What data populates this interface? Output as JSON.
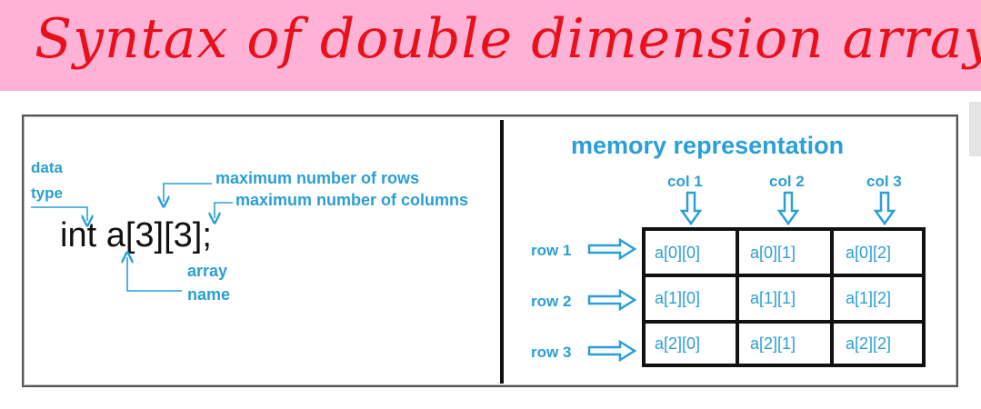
{
  "title": "Syntax of double dimension array",
  "colors": {
    "banner": "#fdb2d6",
    "title": "#e8101a",
    "accent": "#2a9fd6",
    "text": "#111111"
  },
  "syntax": {
    "data_label": "data",
    "type_label": "type",
    "code": "int a[3][3];",
    "rows_label": "maximum number of rows",
    "cols_label": "maximum number of columns",
    "array_label": "array",
    "name_label": "name"
  },
  "memory": {
    "heading": "memory representation",
    "col_labels": [
      "col 1",
      "col 2",
      "col 3"
    ],
    "row_labels": [
      "row 1",
      "row 2",
      "row 3"
    ],
    "cells": [
      [
        "a[0][0]",
        "a[0][1]",
        "a[0][2]"
      ],
      [
        "a[1][0]",
        "a[1][1]",
        "a[1][2]"
      ],
      [
        "a[2][0]",
        "a[2][1]",
        "a[2][2]"
      ]
    ]
  }
}
